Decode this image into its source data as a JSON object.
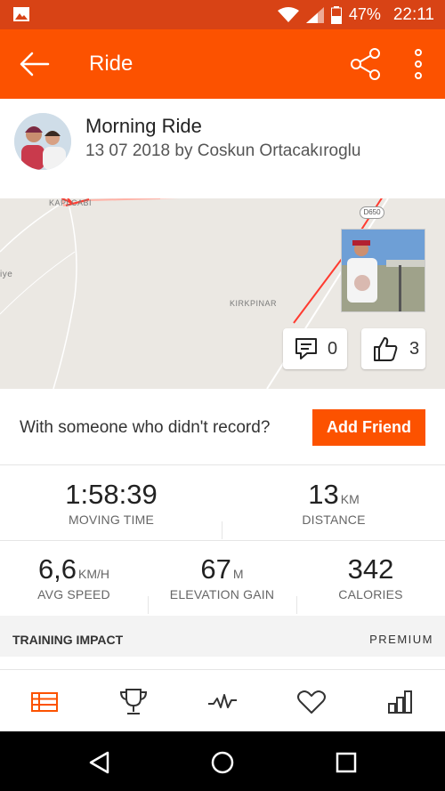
{
  "status_bar": {
    "battery": "47%",
    "time": "22:11",
    "icons": [
      "image-icon",
      "wifi-icon",
      "signal-icon",
      "battery-icon"
    ]
  },
  "app_bar": {
    "title": "Ride",
    "icons": [
      "back-arrow-icon",
      "share-icon",
      "more-vert-icon"
    ]
  },
  "activity": {
    "title": "Morning Ride",
    "subtitle": "13 07 2018 by Coskun Ortacakıroglu"
  },
  "map": {
    "places": [
      "KAPLCABI",
      "iye",
      "KIRKPINAR"
    ],
    "road_badge": "D650",
    "comments_count": "0",
    "kudos_count": "3",
    "route_color": "#ff3b30",
    "icons": [
      "comment-icon",
      "thumbs-up-icon"
    ]
  },
  "friend": {
    "prompt": "With someone who didn't record?",
    "button": "Add Friend"
  },
  "stats": {
    "moving_time": {
      "value": "1:58:39",
      "label": "MOVING TIME"
    },
    "distance": {
      "value": "13",
      "unit": "KM",
      "label": "DISTANCE"
    },
    "avg_speed": {
      "value": "6,6",
      "unit": "KM/H",
      "label": "AVG SPEED"
    },
    "elevation": {
      "value": "67",
      "unit": "M",
      "label": "ELEVATION GAIN"
    },
    "calories": {
      "value": "342",
      "label": "CALORIES"
    }
  },
  "training": {
    "label": "TRAINING IMPACT",
    "premium": "PREMIUM"
  },
  "tabs": {
    "icons": [
      "feed-icon",
      "trophy-icon",
      "activity-pulse-icon",
      "heart-icon",
      "bar-chart-icon"
    ],
    "active": "feed-icon"
  },
  "nav": {
    "icons": [
      "nav-back-icon",
      "nav-home-icon",
      "nav-recents-icon"
    ]
  },
  "colors": {
    "brand": "#fc5200",
    "status_bar": "#d84315"
  }
}
